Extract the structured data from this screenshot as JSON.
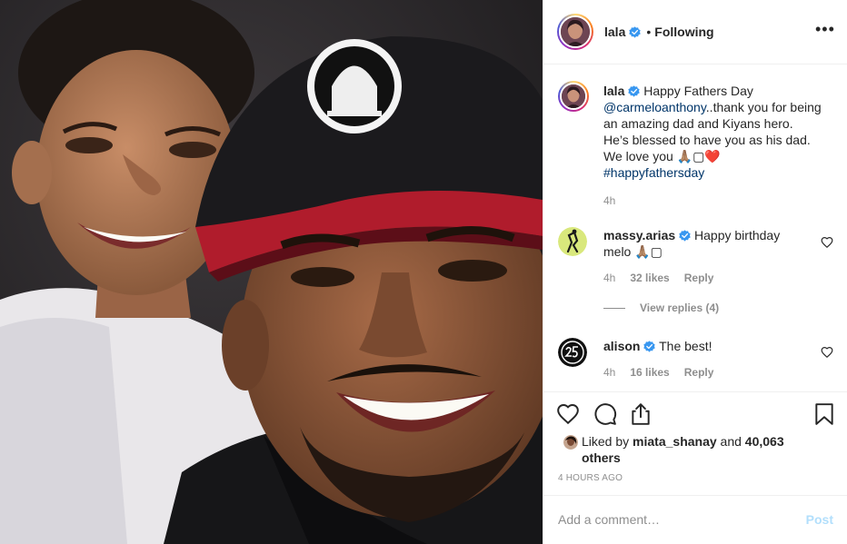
{
  "header": {
    "username": "lala",
    "separator": "•",
    "follow_status": "Following",
    "more_label": "•••"
  },
  "caption": {
    "username": "lala",
    "text_before": "Happy Fathers Day ",
    "mention": "@carmeloanthony",
    "text_after": "..thank you for being an amazing dad and Kiyans hero. He’s blessed to have you as his dad. We love you 🙏🏽▢❤️",
    "hashtag": "#happyfathersday",
    "time": "4h"
  },
  "comments": [
    {
      "username": "massy.arias",
      "text": "Happy birthday melo 🙏🏽▢",
      "time": "4h",
      "likes": "32 likes",
      "reply": "Reply"
    },
    {
      "username": "alison",
      "text": "The best!",
      "time": "4h",
      "likes": "16 likes",
      "reply": "Reply"
    }
  ],
  "view_replies": "View replies (4)",
  "actions": {
    "liked_by_prefix": "Liked by",
    "liked_by_user": "miata_shanay",
    "and": "and",
    "others": "40,063 others",
    "timestamp": "4 hours ago"
  },
  "add_comment": {
    "placeholder": "Add a comment…",
    "post_label": "Post"
  },
  "icons": {
    "verified": "verified-badge-icon",
    "like": "heart-icon",
    "comment": "comment-bubble-icon",
    "share": "share-icon",
    "save": "bookmark-icon",
    "more": "more-options-icon"
  },
  "colors": {
    "verified": "#3897f0",
    "link": "#003569",
    "muted": "#8e8e8e",
    "post_disabled": "#b2dffc"
  }
}
